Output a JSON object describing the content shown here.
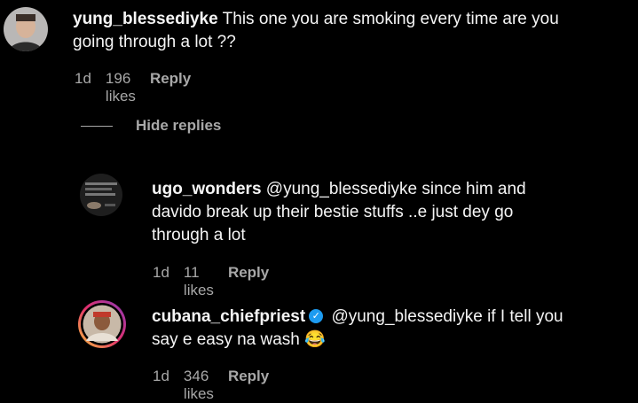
{
  "comments": [
    {
      "username": "yung_blessediyke",
      "text_line1": "This one you are smoking every time are you",
      "text_line2": "going through a lot ??",
      "time": "1d",
      "likes": "196 likes",
      "reply": "Reply"
    },
    {
      "username": "ugo_wonders",
      "text_line1": "@yung_blessediyke since him and",
      "text_line2": "davido break up their bestie stuffs ..e just dey go",
      "text_line3": "through a lot",
      "time": "1d",
      "likes": "11 likes",
      "reply": "Reply"
    },
    {
      "username": "cubana_chiefpriest",
      "verified": true,
      "text_line1": "@yung_blessediyke if I tell you",
      "text_line2": "say e easy na wash",
      "emoji": "😂",
      "time": "1d",
      "likes": "346 likes",
      "reply": "Reply"
    }
  ],
  "hide_replies": "Hide replies",
  "colors": {
    "background": "#000000",
    "text": "#f5f5f5",
    "muted": "#a8a8a8",
    "verified": "#1d9bf0"
  }
}
